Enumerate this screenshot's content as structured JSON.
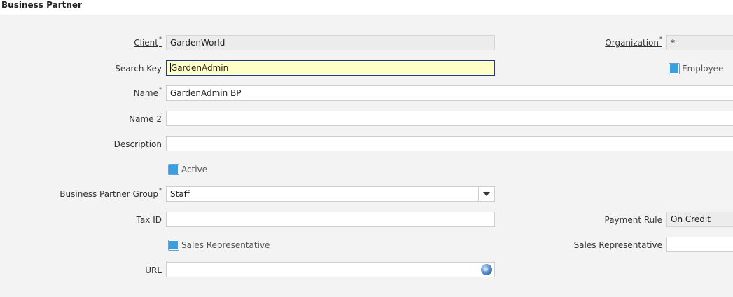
{
  "window": {
    "title": "Business Partner"
  },
  "form": {
    "client": {
      "label": "Client",
      "required": "*",
      "value": "GardenWorld"
    },
    "organization": {
      "label": "Organization",
      "required": "*",
      "value": "*"
    },
    "search_key": {
      "label": "Search Key",
      "value": "GardenAdmin"
    },
    "employee": {
      "label": "Employee",
      "checked": true
    },
    "name": {
      "label": "Name",
      "required": "*",
      "value": "GardenAdmin BP"
    },
    "name2": {
      "label": "Name 2",
      "value": ""
    },
    "description": {
      "label": "Description",
      "value": ""
    },
    "active": {
      "label": "Active",
      "checked": true
    },
    "bp_group": {
      "label": "Business Partner Group",
      "required": "*",
      "value": "Staff"
    },
    "tax_id": {
      "label": "Tax ID",
      "value": ""
    },
    "payment_rule": {
      "label": "Payment Rule",
      "value": "On Credit"
    },
    "sales_rep_check": {
      "label": "Sales Representative",
      "checked": true
    },
    "sales_rep_field": {
      "label": "Sales Representative",
      "value": ""
    },
    "url": {
      "label": "URL",
      "value": ""
    }
  },
  "colors": {
    "focus_bg": "#ffffc6",
    "focus_border": "#1e3a8a",
    "checkbox_fill": "#3a9fe0"
  },
  "icons": {
    "dropdown": "chevron-down-icon",
    "url": "globe-icon"
  }
}
